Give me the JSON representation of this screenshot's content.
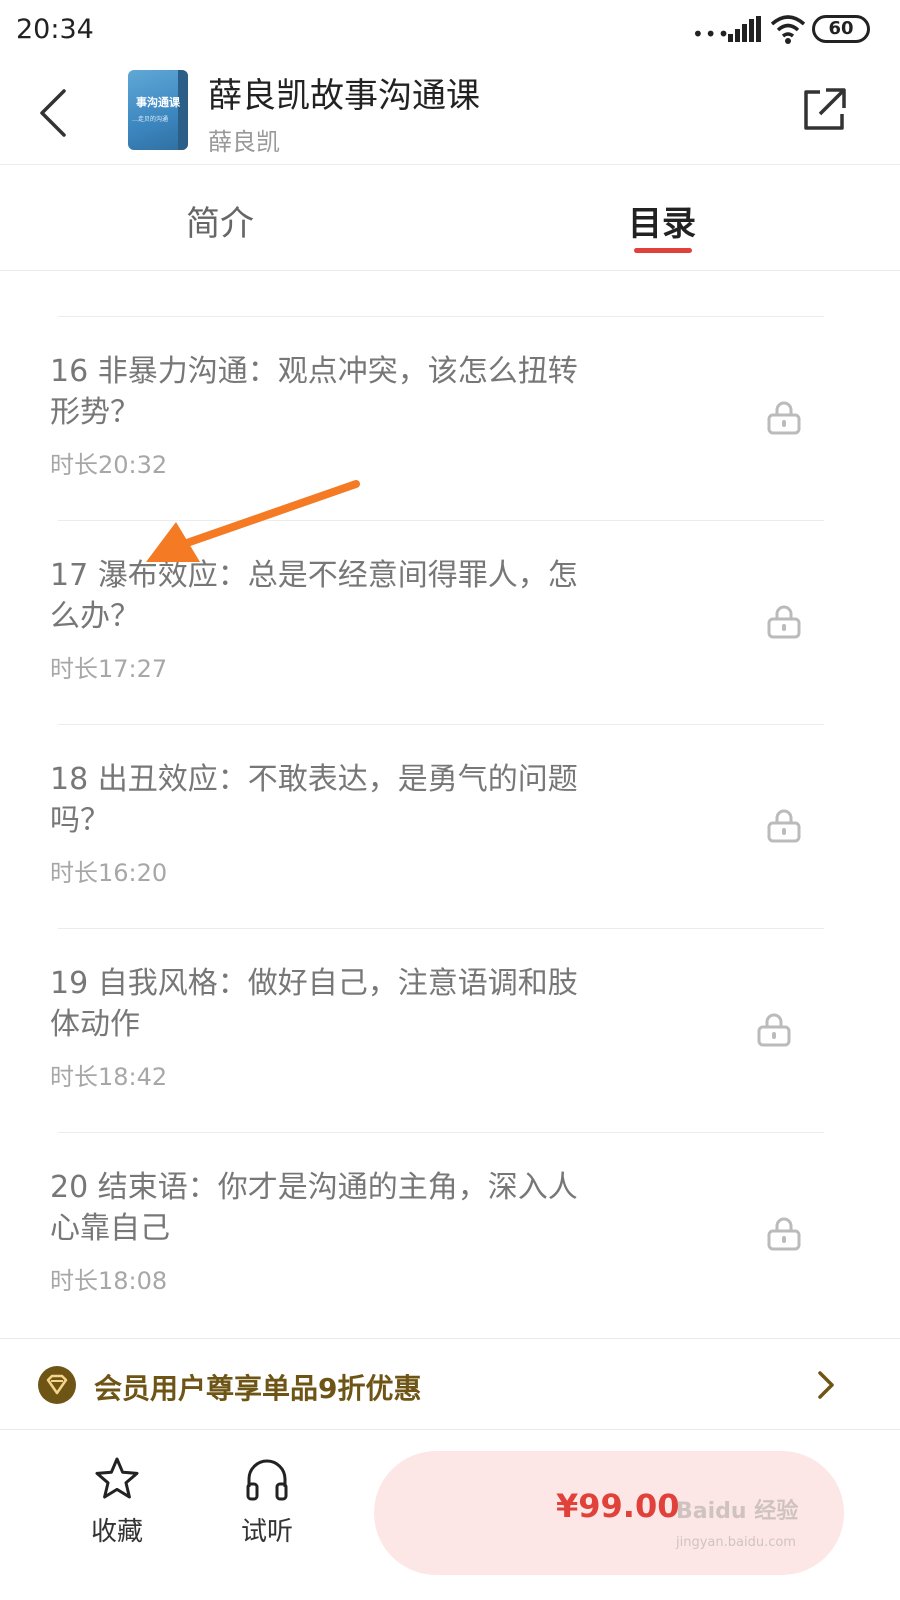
{
  "status_bar": {
    "time": "20:34",
    "dots": "•••",
    "battery": "60",
    "icons": [
      "signal-icon",
      "wifi-icon",
      "battery-icon"
    ]
  },
  "header": {
    "title": "薛良凯故事沟通课",
    "author": "薛良凯",
    "cover_title": "事沟通课",
    "cover_subtitle": "…走贝的沟通",
    "icons": [
      "back-arrow-icon",
      "share-icon"
    ]
  },
  "tabs": [
    {
      "label": "简介",
      "active": false
    },
    {
      "label": "目录",
      "active": true
    }
  ],
  "accent_color": "#e0413a",
  "episodes": [
    {
      "title": "16 非暴力沟通：观点冲突，该怎么扭转形势？",
      "duration": "时长20:32",
      "locked": true
    },
    {
      "title": "17 瀑布效应：总是不经意间得罪人，怎么办？",
      "duration": "时长17:27",
      "locked": true
    },
    {
      "title": "18 出丑效应：不敢表达，是勇气的问题吗？",
      "duration": "时长16:20",
      "locked": true
    },
    {
      "title": "19 自我风格：做好自己，注意语调和肢体动作",
      "duration": "时长18:42",
      "locked": true
    },
    {
      "title": "20 结束语：你才是沟通的主角，深入人心靠自己",
      "duration": "时长18:08",
      "locked": true
    }
  ],
  "member_bar": {
    "text": "会员用户尊享单品9折优惠",
    "color": "#6e5515"
  },
  "bottom_bar": {
    "favorite_label": "收藏",
    "listen_label": "试听",
    "price": "¥99.00",
    "watermark": "Baidu 经验",
    "watermark_sub": "jingyan.baidu.com"
  }
}
